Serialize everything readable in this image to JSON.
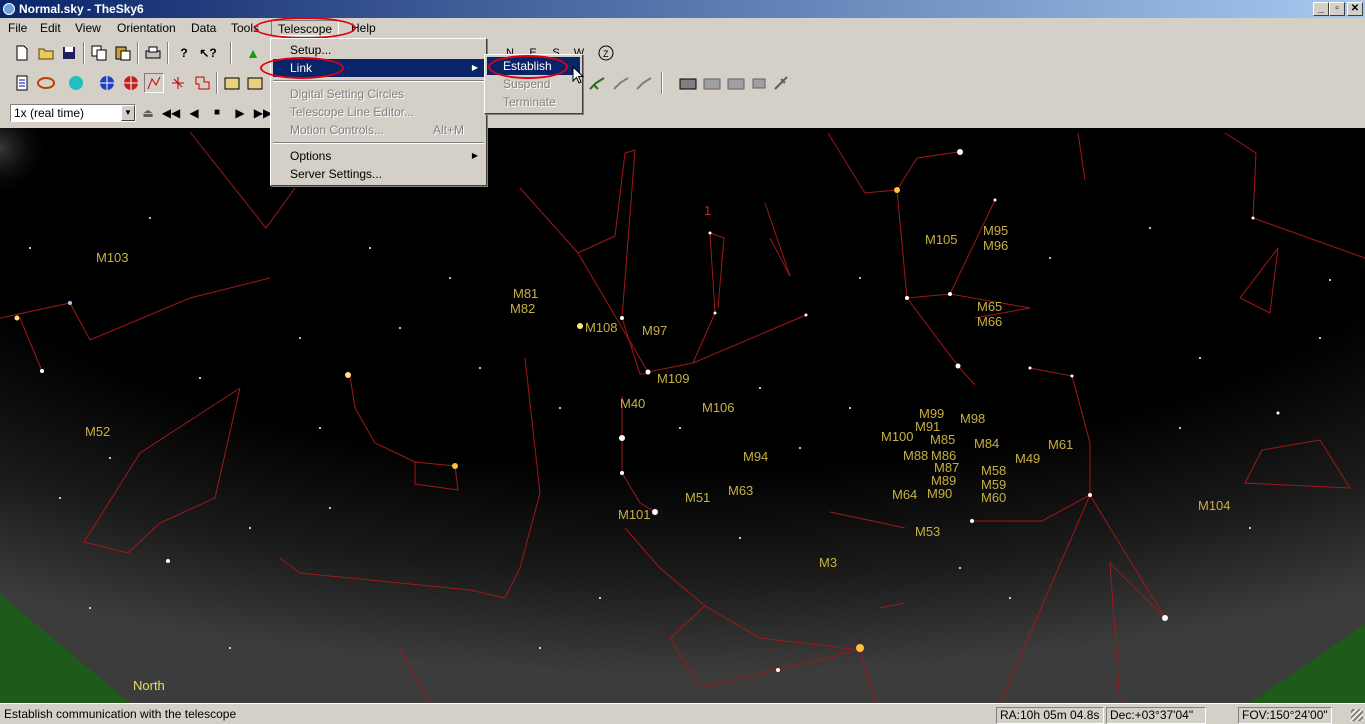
{
  "window": {
    "title": "Normal.sky - TheSky6"
  },
  "menubar": {
    "items": [
      "File",
      "Edit",
      "View",
      "Orientation",
      "Data",
      "Tools",
      "Telescope",
      "Help"
    ]
  },
  "toolbar3": {
    "speed_value": "1x (real time)"
  },
  "toolbar1": {
    "compass": [
      "N",
      "E",
      "S",
      "W"
    ]
  },
  "telescope_menu": {
    "items": [
      {
        "label": "Setup...",
        "enabled": true
      },
      {
        "label": "Link",
        "enabled": true,
        "submenu": true,
        "selected": true
      },
      {
        "label": "Digital Setting Circles",
        "enabled": false
      },
      {
        "label": "Telescope Line Editor...",
        "enabled": false
      },
      {
        "label": "Motion Controls...",
        "enabled": false,
        "shortcut": "Alt+M"
      },
      {
        "label": "Options",
        "enabled": true,
        "submenu": true
      },
      {
        "label": "Server Settings...",
        "enabled": true
      }
    ]
  },
  "link_submenu": {
    "items": [
      {
        "label": "Establish",
        "enabled": true,
        "selected": true
      },
      {
        "label": "Suspend",
        "enabled": false
      },
      {
        "label": "Terminate",
        "enabled": false
      }
    ]
  },
  "sky": {
    "horizon_label": "North",
    "marker_label": "1",
    "objects": [
      "M103",
      "M52",
      "M81",
      "M82",
      "M108",
      "M97",
      "M109",
      "M40",
      "M106",
      "M94",
      "M63",
      "M51",
      "M101",
      "M3",
      "M53",
      "M64",
      "M90",
      "M89",
      "M87",
      "M88",
      "M86",
      "M100",
      "M85",
      "M91",
      "M99",
      "M98",
      "M84",
      "M58",
      "M59",
      "M60",
      "M49",
      "M61",
      "M104",
      "M105",
      "M95",
      "M96",
      "M65",
      "M66"
    ]
  },
  "statusbar": {
    "message": "Establish communication with the telescope",
    "ra": "RA:10h 05m 04.8s",
    "dec": "Dec:+03°37'04\"",
    "fov": "FOV:150°24'00\""
  },
  "colors": {
    "titlebar": "#0a246a",
    "menu_highlight": "#0a246a",
    "annotation": "#e00010",
    "messier_label": "#c8b040",
    "constellation": "#a01818",
    "horizon": "#1e5a1a"
  }
}
